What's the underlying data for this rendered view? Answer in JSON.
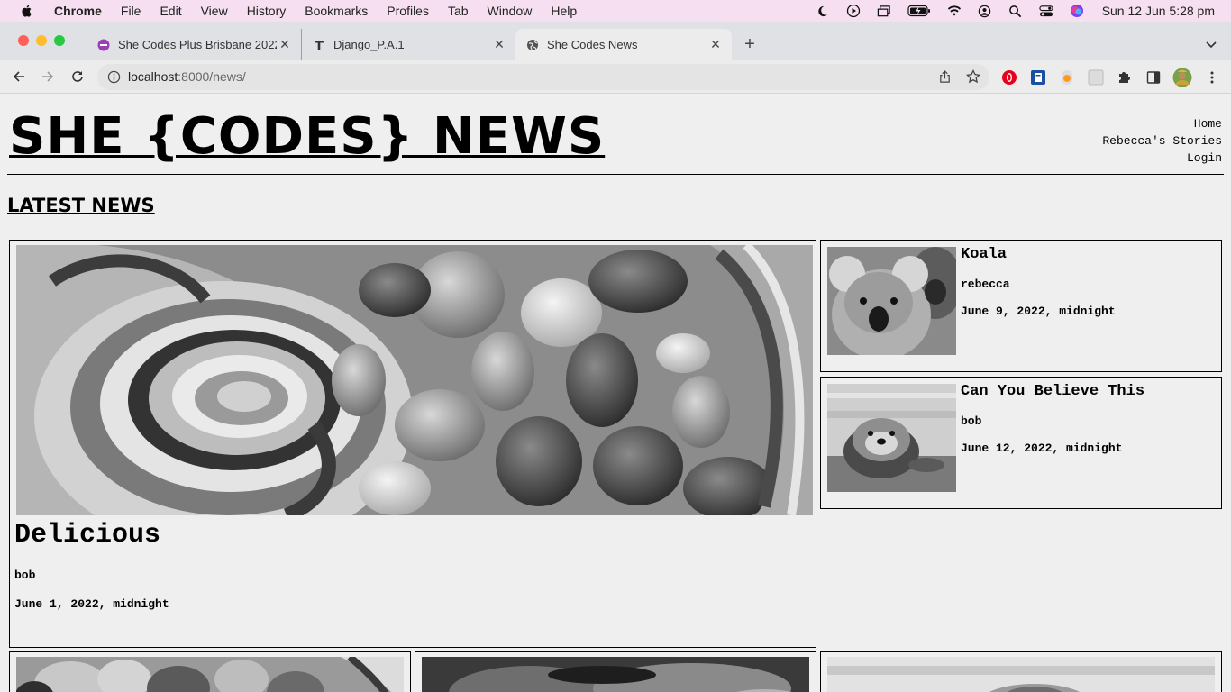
{
  "menubar": {
    "app": "Chrome",
    "items": [
      "File",
      "Edit",
      "View",
      "History",
      "Bookmarks",
      "Profiles",
      "Tab",
      "Window",
      "Help"
    ],
    "clock": "Sun 12 Jun  5:28 pm"
  },
  "tabs": [
    {
      "label": "She Codes Plus Brisbane 2022",
      "active": false
    },
    {
      "label": "Django_P.A.1",
      "active": false
    },
    {
      "label": "She Codes News",
      "active": true
    }
  ],
  "address": {
    "host": "localhost",
    "rest": ":8000/news/"
  },
  "site": {
    "title": "SHE {CODES} NEWS",
    "nav": [
      "Home",
      "Rebecca's Stories",
      "Login"
    ]
  },
  "section_title": "LATEST NEWS",
  "featured": {
    "title": "Delicious",
    "author": "bob",
    "date": "June 1, 2022, midnight"
  },
  "stories": [
    {
      "title": "Koala",
      "author": "rebecca",
      "date": "June 9, 2022, midnight"
    },
    {
      "title": "Can You Believe This",
      "author": "bob",
      "date": "June 12, 2022, midnight"
    }
  ],
  "colors": {
    "close": "#fe5f57",
    "minimize": "#febc2e",
    "zoom": "#28c840",
    "menubar_bg": "#f6dff0"
  }
}
